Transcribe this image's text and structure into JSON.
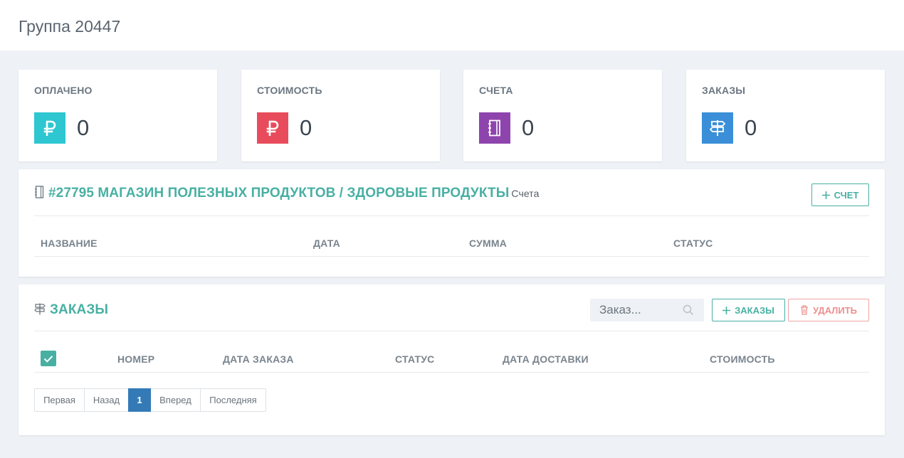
{
  "page": {
    "title": "Группа 20447"
  },
  "stats": [
    {
      "label": "ОПЛАЧЕНО",
      "value": "0",
      "icon": "ruble-icon",
      "color": "#2ec6d0"
    },
    {
      "label": "СТОИМОСТЬ",
      "value": "0",
      "icon": "ruble-icon",
      "color": "#e84c5c"
    },
    {
      "label": "СЧЕТА",
      "value": "0",
      "icon": "notebook-icon",
      "color": "#8e44ad"
    },
    {
      "label": "ЗАКАЗЫ",
      "value": "0",
      "icon": "signpost-icon",
      "color": "#3a8fd8"
    }
  ],
  "invoices": {
    "title": "#27795 МАГАЗИН ПОЛЕЗНЫХ ПРОДУКТОВ / ЗДОРОВЫЕ ПРОДУКТЫ",
    "subtitle": "Счета",
    "icon": "notebook-icon",
    "add_button": "СЧЕТ",
    "columns": [
      "НАЗВАНИЕ",
      "ДАТА",
      "СУММА",
      "СТАТУС"
    ],
    "rows": []
  },
  "orders": {
    "title": "ЗАКАЗЫ",
    "icon": "signpost-icon",
    "search_placeholder": "Заказ...",
    "add_button": "ЗАКАЗЫ",
    "delete_button": "УДАЛИТЬ",
    "select_all_checked": true,
    "columns": [
      "НОМЕР",
      "ДАТА ЗАКАЗА",
      "СТАТУС",
      "ДАТА ДОСТАВКИ",
      "СТОИМОСТЬ"
    ],
    "rows": []
  },
  "pagination": {
    "first": "Первая",
    "prev": "Назад",
    "current": "1",
    "next": "Вперед",
    "last": "Последняя"
  },
  "colors": {
    "accent": "#48b0a3",
    "danger": "#ec8f8f",
    "pager_active": "#337ab7"
  }
}
